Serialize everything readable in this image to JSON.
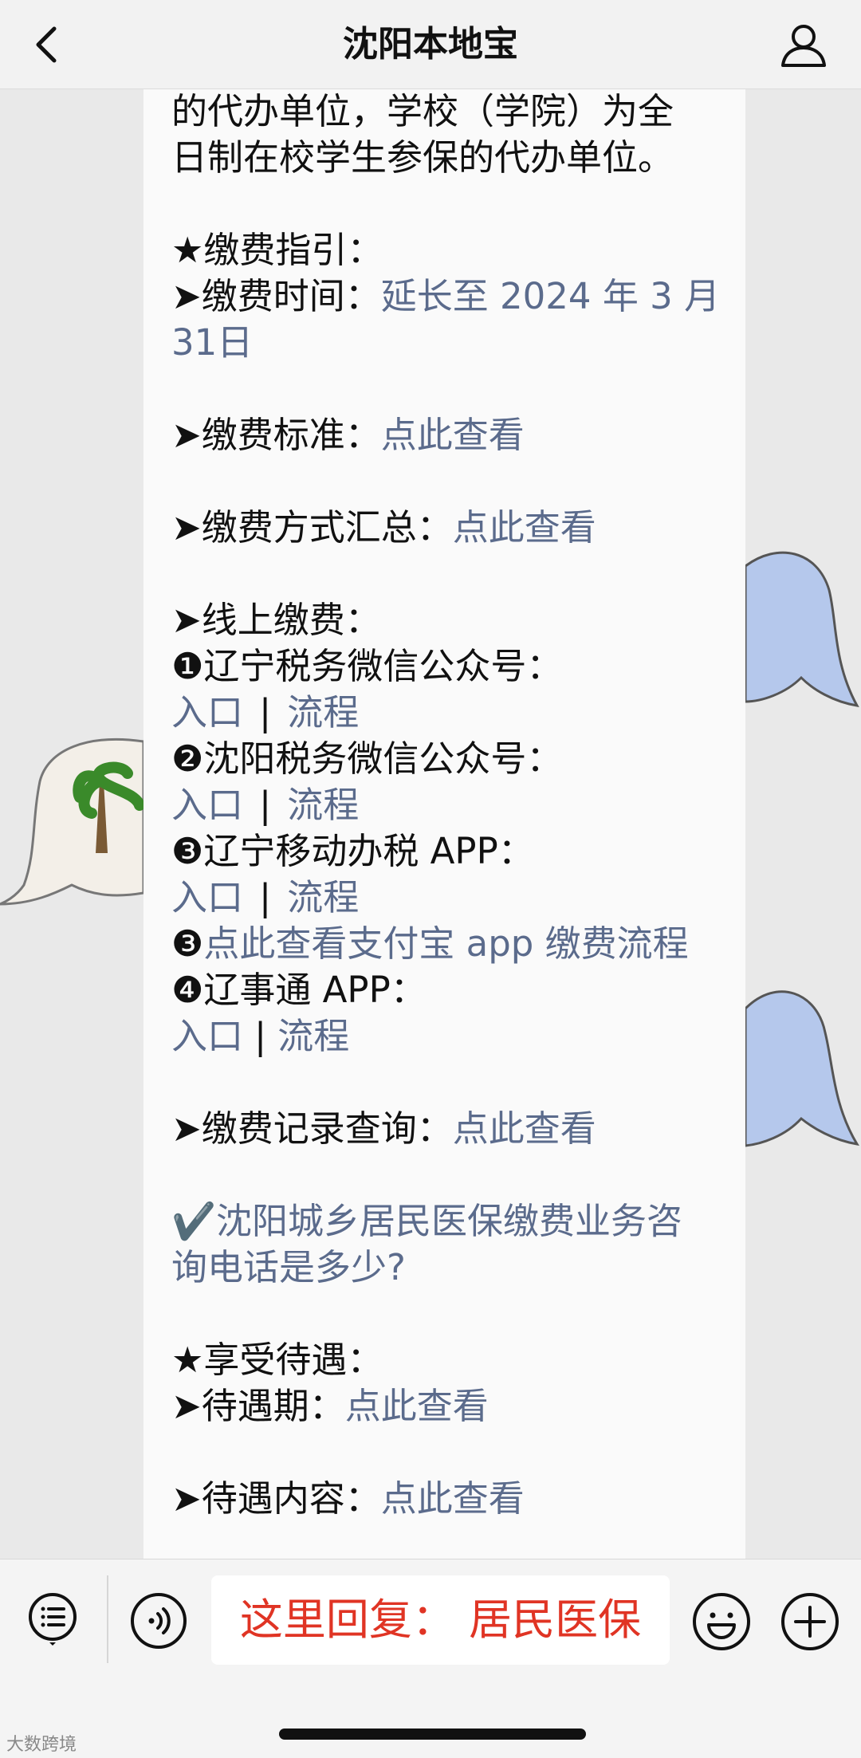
{
  "nav": {
    "title": "沈阳本地宝"
  },
  "article": {
    "intro_line_1": "的代办单位，学校（学院）为全",
    "intro_line_2": "日制在校学生参保的代办单位。",
    "payment_guide_heading": "★缴费指引：",
    "payment_time_label": "➤缴费时间：",
    "payment_time_value_1": "延长至 2024 年 3 月",
    "payment_time_value_2": "31日",
    "payment_standard_label": "➤缴费标准：",
    "payment_methods_label": "➤缴费方式汇总：",
    "online_payment_label": "➤线上缴费：",
    "channels": [
      {
        "label": "❶辽宁税务微信公众号：",
        "entry": "入口",
        "sep": "|",
        "flow": "流程"
      },
      {
        "label": "❷沈阳税务微信公众号：",
        "entry": "入口",
        "sep": "|",
        "flow": "流程"
      },
      {
        "label": "❸辽宁移动办税 APP：",
        "entry": "入口",
        "sep": "|",
        "flow": "流程"
      }
    ],
    "alipay_prefix": "❸",
    "alipay_link": "点此查看支付宝 app 缴费流程",
    "liaoshitong_label": "❹辽事通 APP：",
    "liaoshitong_entry": "入口",
    "liaoshitong_sep": "|",
    "liaoshitong_flow": "流程",
    "record_query_label": "➤缴费记录查询：",
    "faq_link_1": "✔️沈阳城乡居民医保缴费业务咨",
    "faq_link_2": "询电话是多少?",
    "benefits_heading": "★享受待遇：",
    "waiting_period_label": "➤待遇期：",
    "benefit_content_label": "➤待遇内容：",
    "view_link": "点此查看"
  },
  "bottom": {
    "reply_hint": "这里回复：  居民医保"
  },
  "watermark": "大数跨境",
  "colors": {
    "link": "#5b6b8c",
    "reply": "#e03424"
  }
}
